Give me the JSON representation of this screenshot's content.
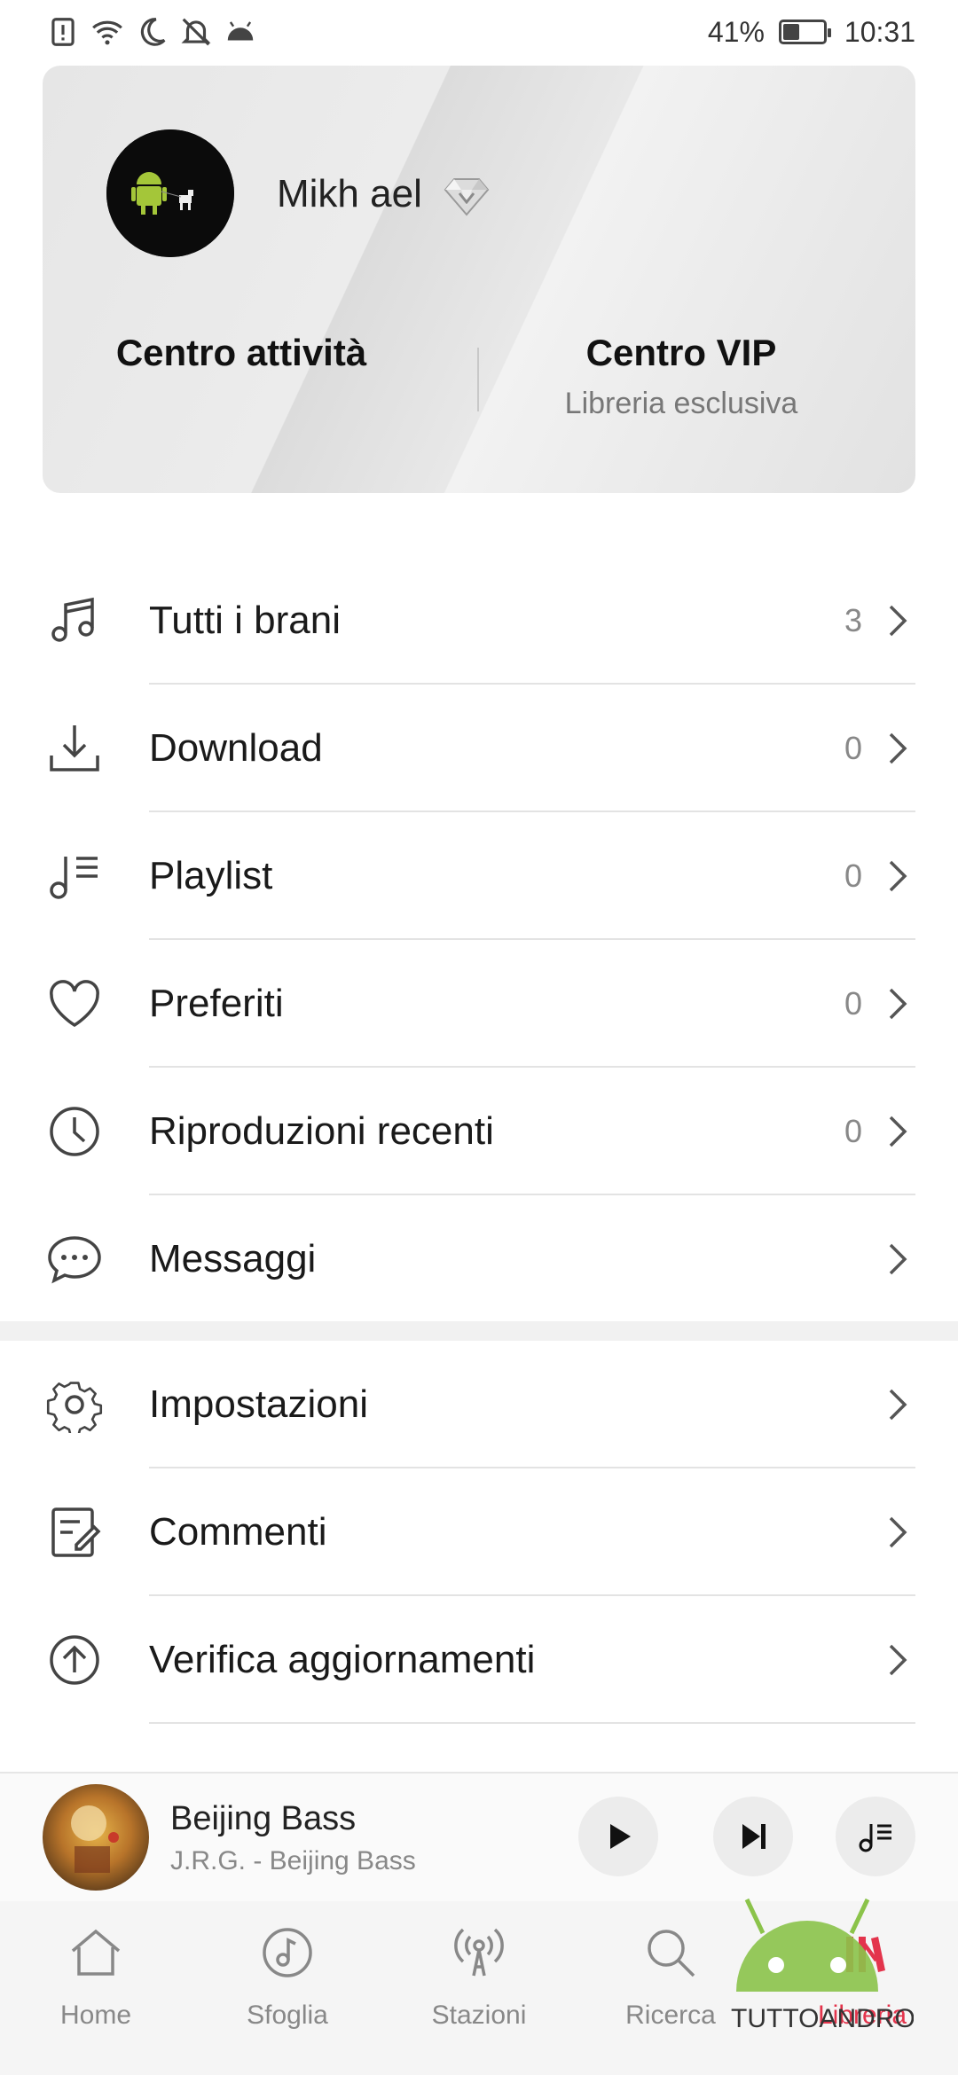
{
  "status_bar": {
    "icons": [
      "alert-icon",
      "wifi-icon",
      "moon-icon",
      "bell-off-icon",
      "android-icon"
    ],
    "battery_text": "41%",
    "battery_level": 0.41,
    "time": "10:31"
  },
  "profile": {
    "name": "Mikh ael",
    "badge_icon": "diamond-icon",
    "actions": [
      {
        "title": "Centro attività",
        "subtitle": ""
      },
      {
        "title": "Centro VIP",
        "subtitle": "Libreria esclusiva"
      }
    ]
  },
  "menu": {
    "group1": [
      {
        "icon": "music-note-icon",
        "label": "Tutti i brani",
        "count": "3"
      },
      {
        "icon": "download-icon",
        "label": "Download",
        "count": "0"
      },
      {
        "icon": "playlist-icon",
        "label": "Playlist",
        "count": "0"
      },
      {
        "icon": "heart-icon",
        "label": "Preferiti",
        "count": "0"
      },
      {
        "icon": "clock-icon",
        "label": "Riproduzioni recenti",
        "count": "0"
      },
      {
        "icon": "chat-bubble-icon",
        "label": "Messaggi",
        "count": ""
      }
    ],
    "group2": [
      {
        "icon": "gear-icon",
        "label": "Impostazioni",
        "count": ""
      },
      {
        "icon": "edit-note-icon",
        "label": "Commenti",
        "count": ""
      },
      {
        "icon": "arrow-up-circle-icon",
        "label": "Verifica aggiornamenti",
        "count": ""
      }
    ]
  },
  "player": {
    "title": "Beijing Bass",
    "artist": "J.R.G. - Beijing Bass"
  },
  "bottom_nav": [
    {
      "icon": "home-icon",
      "label": "Home"
    },
    {
      "icon": "browse-icon",
      "label": "Sfoglia"
    },
    {
      "icon": "radio-tower-icon",
      "label": "Stazioni"
    },
    {
      "icon": "search-icon",
      "label": "Ricerca"
    },
    {
      "icon": "library-icon",
      "label": "Libreria",
      "active": true
    }
  ],
  "watermark": "TUTTOANDROID",
  "colors": {
    "accent": "#e3344c",
    "card_bg": "#e8e8e8",
    "text_secondary": "#888888"
  }
}
